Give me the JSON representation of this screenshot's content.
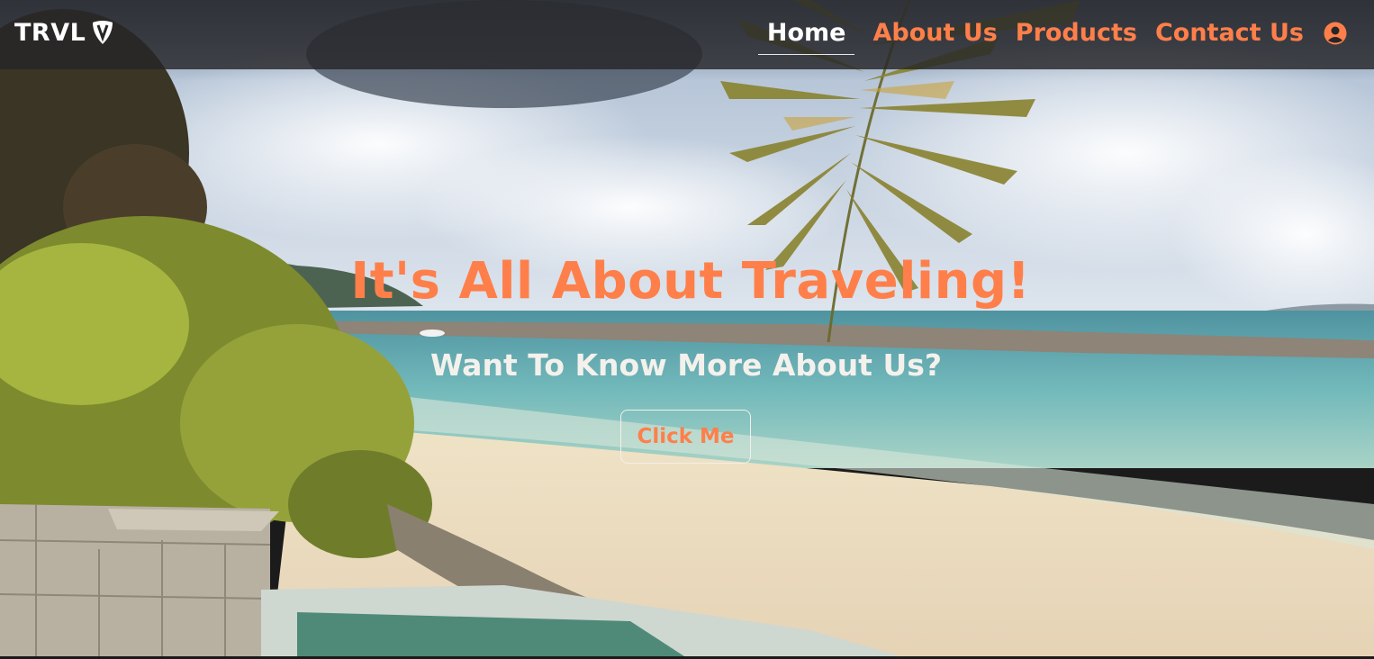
{
  "brand": {
    "name": "TRVL",
    "logo_icon": "shield-v-icon"
  },
  "nav": {
    "items": [
      {
        "label": "Home",
        "active": true
      },
      {
        "label": "About Us",
        "active": false
      },
      {
        "label": "Products",
        "active": false
      },
      {
        "label": "Contact Us",
        "active": false
      }
    ],
    "user_icon": "user-circle-icon"
  },
  "hero": {
    "title": "It's All About Traveling!",
    "subtitle": "Want To Know More About Us?",
    "cta_label": "Click Me",
    "background": "beach-scene-video"
  },
  "colors": {
    "accent": "#ff7f4a",
    "nav_background": "#262628",
    "text_light": "#ffffff"
  }
}
